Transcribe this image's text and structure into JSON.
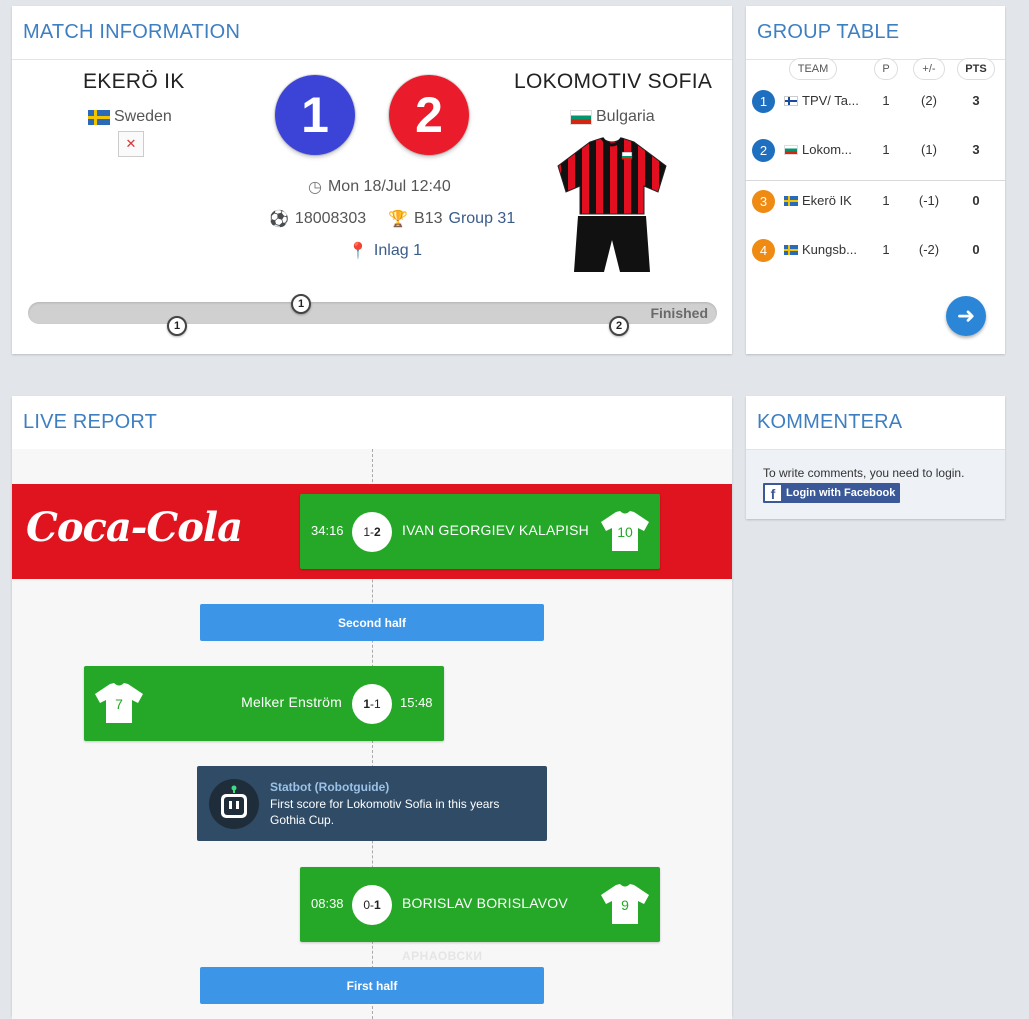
{
  "match": {
    "title": "MATCH INFORMATION",
    "home": {
      "name": "EKERÖ IK",
      "country": "Sweden",
      "score": "1",
      "color": "#3c44d8"
    },
    "away": {
      "name": "LOKOMOTIV SOFIA",
      "country": "Bulgaria",
      "score": "2",
      "color": "#ea1b2a"
    },
    "datetime": "Mon 18/Jul 12:40",
    "match_id": "18008303",
    "category": "B13",
    "group": "Group 31",
    "venue": "Inlag 1",
    "status": "Finished",
    "progress_markers": [
      {
        "label": "1",
        "side": "home"
      },
      {
        "label": "1",
        "side": "away"
      },
      {
        "label": "2",
        "side": "away"
      }
    ]
  },
  "group_table": {
    "title": "GROUP TABLE",
    "headers": [
      "TEAM",
      "P",
      "+/-",
      "PTS"
    ],
    "rows": [
      {
        "pos": "1",
        "flag": "fi",
        "team": "TPV/ Ta...",
        "p": "1",
        "diff": "(2)",
        "pts": "3",
        "pos_color": "#1f6fc0"
      },
      {
        "pos": "2",
        "flag": "bg",
        "team": "Lokom...",
        "p": "1",
        "diff": "(1)",
        "pts": "3",
        "pos_color": "#1f6fc0"
      },
      {
        "pos": "3",
        "flag": "se",
        "team": "Ekerö IK",
        "p": "1",
        "diff": "(-1)",
        "pts": "0",
        "pos_color": "#ef8a12"
      },
      {
        "pos": "4",
        "flag": "se",
        "team": "Kungsb...",
        "p": "1",
        "diff": "(-2)",
        "pts": "0",
        "pos_color": "#ef8a12"
      }
    ],
    "next_icon": "arrow-right-icon"
  },
  "live_report": {
    "title": "LIVE REPORT",
    "sponsor": "Coca-Cola",
    "events": [
      {
        "type": "goal",
        "side": "away",
        "time": "34:16",
        "score_home": "1",
        "score_away": "2",
        "player": "IVAN GEORGIEV KALAPISH",
        "shirt": "10"
      },
      {
        "type": "period",
        "label": "Second half"
      },
      {
        "type": "goal",
        "side": "home",
        "time": "15:48",
        "score_home": "1",
        "score_away": "1",
        "player": "Melker Enström",
        "shirt": "7"
      },
      {
        "type": "statbot",
        "author": "Statbot (Robotguide)",
        "text": "First score for Lokomotiv Sofia in this years Gothia Cup."
      },
      {
        "type": "goal",
        "side": "away",
        "time": "08:38",
        "score_home": "0",
        "score_away": "1",
        "player": "BORISLAV BORISLAVOV",
        "shirt": "9"
      },
      {
        "type": "period",
        "label": "First half"
      }
    ],
    "ghost_text": "АРНАОВСКИ"
  },
  "comments": {
    "title": "KOMMENTERA",
    "text": "To write comments, you need to login.",
    "facebook_button": "Login with Facebook"
  }
}
